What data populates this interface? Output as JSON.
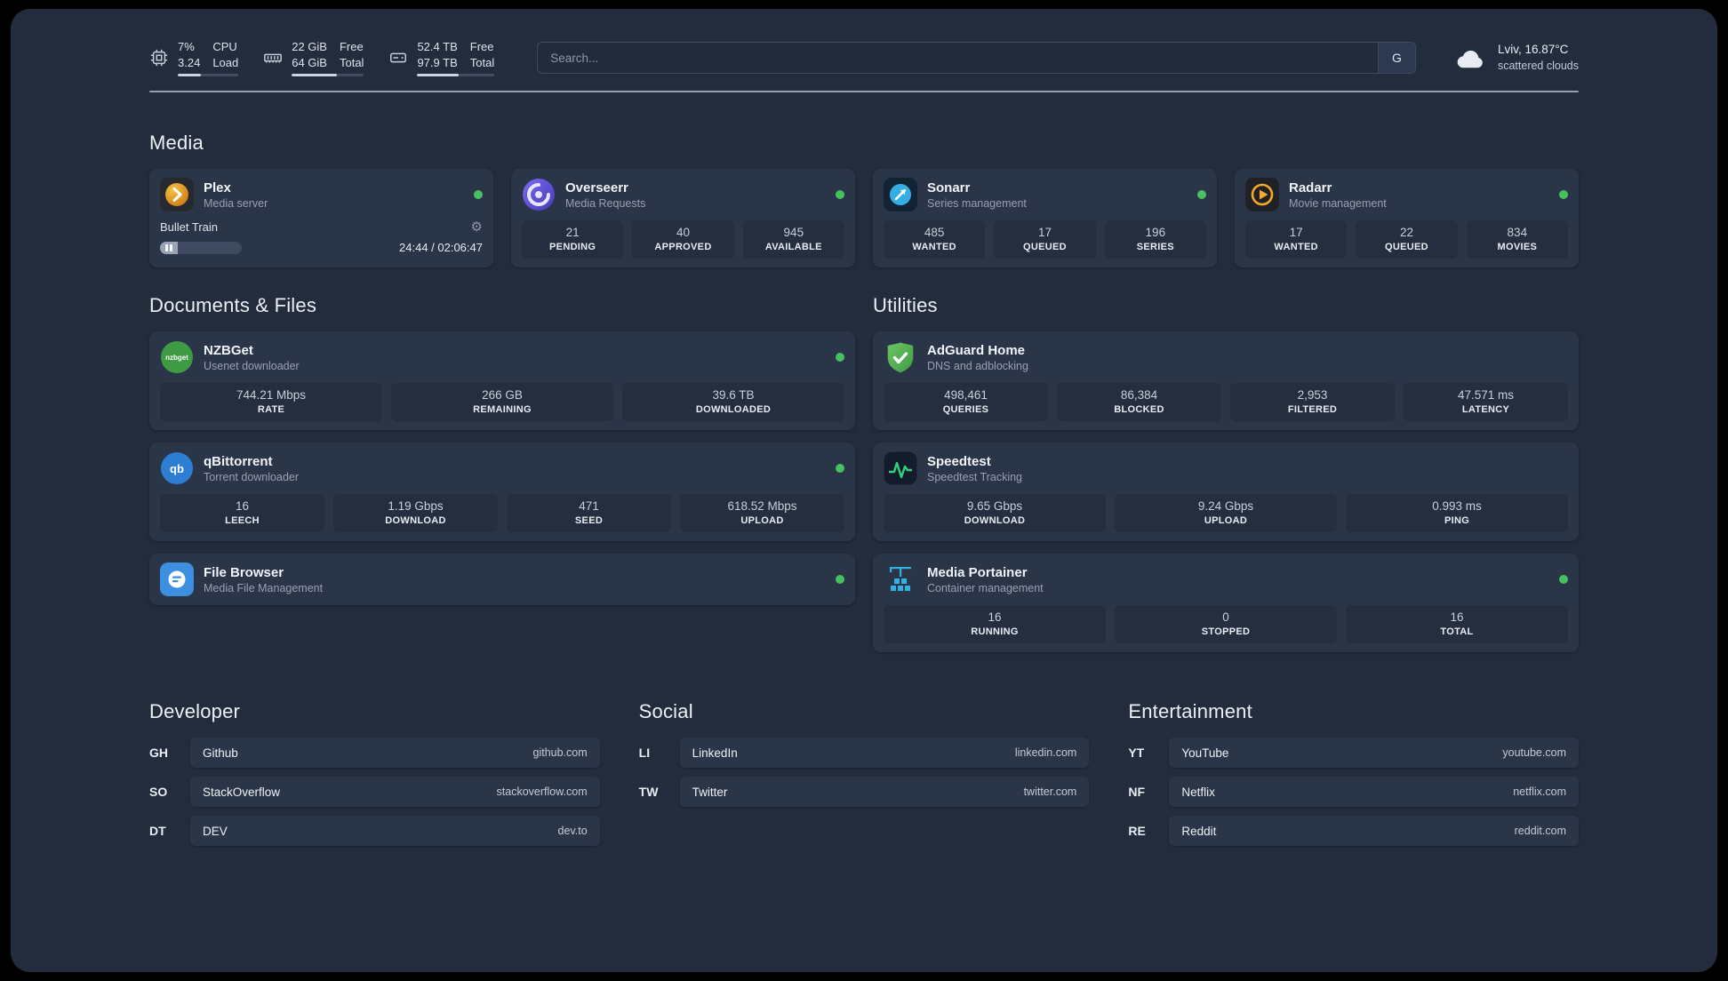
{
  "topbar": {
    "stats": [
      {
        "icon": "cpu-icon",
        "value": "7%",
        "sub": "3.24",
        "label_top": "CPU",
        "label_bottom": "Load",
        "fill_pct": 38
      },
      {
        "icon": "ram-icon",
        "value": "22 GiB",
        "sub": "64 GiB",
        "label_top": "Free",
        "label_bottom": "Total",
        "fill_pct": 62
      },
      {
        "icon": "disk-icon",
        "value": "52.4 TB",
        "sub": "97.9 TB",
        "label_top": "Free",
        "label_bottom": "Total",
        "fill_pct": 54
      }
    ],
    "search": {
      "placeholder": "Search...",
      "button_label": "G"
    },
    "weather": {
      "location": "Lviv, 16.87°C",
      "condition": "scattered clouds"
    }
  },
  "sections": {
    "media": {
      "title": "Media",
      "apps": [
        {
          "name": "Plex",
          "subtitle": "Media server",
          "online": true,
          "player": {
            "track": "Bullet Train",
            "time": "24:44 / 02:06:47",
            "progress_pct": 22
          }
        },
        {
          "name": "Overseerr",
          "subtitle": "Media Requests",
          "online": true,
          "stats": [
            {
              "value": "21",
              "label": "PENDING"
            },
            {
              "value": "40",
              "label": "APPROVED"
            },
            {
              "value": "945",
              "label": "AVAILABLE"
            }
          ]
        },
        {
          "name": "Sonarr",
          "subtitle": "Series management",
          "online": true,
          "stats": [
            {
              "value": "485",
              "label": "WANTED"
            },
            {
              "value": "17",
              "label": "QUEUED"
            },
            {
              "value": "196",
              "label": "SERIES"
            }
          ]
        },
        {
          "name": "Radarr",
          "subtitle": "Movie management",
          "online": true,
          "stats": [
            {
              "value": "17",
              "label": "WANTED"
            },
            {
              "value": "22",
              "label": "QUEUED"
            },
            {
              "value": "834",
              "label": "MOVIES"
            }
          ]
        }
      ]
    },
    "documents": {
      "title": "Documents & Files",
      "apps": [
        {
          "name": "NZBGet",
          "subtitle": "Usenet downloader",
          "online": true,
          "stats": [
            {
              "value": "744.21 Mbps",
              "label": "RATE"
            },
            {
              "value": "266 GB",
              "label": "REMAINING"
            },
            {
              "value": "39.6 TB",
              "label": "DOWNLOADED"
            }
          ]
        },
        {
          "name": "qBittorrent",
          "subtitle": "Torrent downloader",
          "online": true,
          "stats": [
            {
              "value": "16",
              "label": "LEECH"
            },
            {
              "value": "1.19 Gbps",
              "label": "DOWNLOAD"
            },
            {
              "value": "471",
              "label": "SEED"
            },
            {
              "value": "618.52 Mbps",
              "label": "UPLOAD"
            }
          ]
        },
        {
          "name": "File Browser",
          "subtitle": "Media File Management",
          "online": true
        }
      ]
    },
    "utilities": {
      "title": "Utilities",
      "apps": [
        {
          "name": "AdGuard Home",
          "subtitle": "DNS and adblocking",
          "stats": [
            {
              "value": "498,461",
              "label": "QUERIES"
            },
            {
              "value": "86,384",
              "label": "BLOCKED"
            },
            {
              "value": "2,953",
              "label": "FILTERED"
            },
            {
              "value": "47.571 ms",
              "label": "LATENCY"
            }
          ]
        },
        {
          "name": "Speedtest",
          "subtitle": "Speedtest Tracking",
          "stats": [
            {
              "value": "9.65 Gbps",
              "label": "DOWNLOAD"
            },
            {
              "value": "9.24 Gbps",
              "label": "UPLOAD"
            },
            {
              "value": "0.993 ms",
              "label": "PING"
            }
          ]
        },
        {
          "name": "Media Portainer",
          "subtitle": "Container management",
          "online": true,
          "stats": [
            {
              "value": "16",
              "label": "RUNNING"
            },
            {
              "value": "0",
              "label": "STOPPED"
            },
            {
              "value": "16",
              "label": "TOTAL"
            }
          ]
        }
      ]
    }
  },
  "bookmarks": [
    {
      "title": "Developer",
      "items": [
        {
          "abbr": "GH",
          "name": "Github",
          "url": "github.com"
        },
        {
          "abbr": "SO",
          "name": "StackOverflow",
          "url": "stackoverflow.com"
        },
        {
          "abbr": "DT",
          "name": "DEV",
          "url": "dev.to"
        }
      ]
    },
    {
      "title": "Social",
      "items": [
        {
          "abbr": "LI",
          "name": "LinkedIn",
          "url": "linkedin.com"
        },
        {
          "abbr": "TW",
          "name": "Twitter",
          "url": "twitter.com"
        }
      ]
    },
    {
      "title": "Entertainment",
      "items": [
        {
          "abbr": "YT",
          "name": "YouTube",
          "url": "youtube.com"
        },
        {
          "abbr": "NF",
          "name": "Netflix",
          "url": "netflix.com"
        },
        {
          "abbr": "RE",
          "name": "Reddit",
          "url": "reddit.com"
        }
      ]
    }
  ],
  "colors": {
    "status_online": "#46c060",
    "page_bg": "#232c3d",
    "card_bg": "#2b3548"
  }
}
